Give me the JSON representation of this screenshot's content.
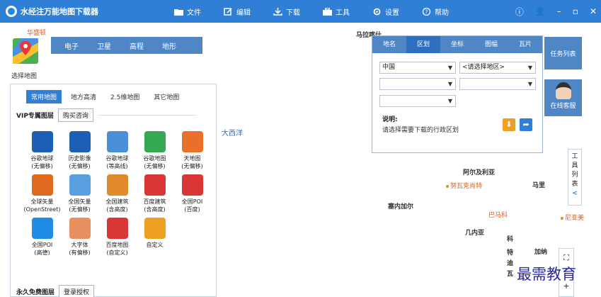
{
  "app": {
    "title": "水经注万能地图下载器",
    "menu": [
      {
        "label": "文件",
        "icon": "folder-icon"
      },
      {
        "label": "编辑",
        "icon": "edit-icon"
      },
      {
        "label": "下载",
        "icon": "download-icon"
      },
      {
        "label": "工具",
        "icon": "toolbox-icon"
      },
      {
        "label": "设置",
        "icon": "gear-icon"
      },
      {
        "label": "帮助",
        "icon": "help-icon"
      }
    ],
    "window_controls": [
      "ⓘ",
      "👤",
      "–",
      "▫",
      "✕"
    ]
  },
  "map": {
    "map_selector_label": "选择地图",
    "map_types": [
      "电子",
      "卫星",
      "高程",
      "地形"
    ],
    "ocean_label": "大西洋",
    "places": [
      {
        "text": "华盛顿"
      },
      {
        "text": "马拉喀什"
      },
      {
        "text": "阿尔及利亚"
      },
      {
        "text": "努瓦克肖特"
      },
      {
        "text": "马里"
      },
      {
        "text": "塞内加尔"
      },
      {
        "text": "巴马科"
      },
      {
        "text": "几内亚"
      },
      {
        "text": "科"
      },
      {
        "text": "特"
      },
      {
        "text": "迪"
      },
      {
        "text": "瓦"
      },
      {
        "text": "加纳"
      },
      {
        "text": "尼亚美"
      }
    ]
  },
  "left_panel": {
    "tabs": [
      "常用地图",
      "地方高清",
      "2.5维地图",
      "其它地图"
    ],
    "vip_section": {
      "title": "VIP专属图层",
      "button": "购买咨询"
    },
    "tiles": [
      {
        "name": "谷歌地球",
        "sub": "(无偏移)",
        "icon": "google-earth-icon",
        "color": "#1d5fb5"
      },
      {
        "name": "历史影像",
        "sub": "(无偏移)",
        "icon": "history-icon",
        "color": "#1d5fb5"
      },
      {
        "name": "谷歌地球",
        "sub": "(等高线)",
        "icon": "contour-icon",
        "color": "#4a90d9"
      },
      {
        "name": "谷歌地图",
        "sub": "(无偏移)",
        "icon": "google-maps-icon",
        "color": "#34a853"
      },
      {
        "name": "天地图",
        "sub": "(无偏移)",
        "icon": "tianditu-icon",
        "color": "#e8702a"
      },
      {
        "name": "全球矢量",
        "sub": "(OpenStreet)",
        "icon": "world-vector-icon",
        "color": "#e06a1e"
      },
      {
        "name": "全国矢量",
        "sub": "(无偏移)",
        "icon": "china-vector-icon",
        "color": "#5aa0e0"
      },
      {
        "name": "全国建筑",
        "sub": "(含高度)",
        "icon": "building-icon",
        "color": "#e08a2c"
      },
      {
        "name": "百度建筑",
        "sub": "(含高度)",
        "icon": "baidu-icon",
        "color": "#d93636"
      },
      {
        "name": "全国POI",
        "sub": "(百度)",
        "icon": "poi-icon",
        "color": "#d93636"
      },
      {
        "name": "全国POI",
        "sub": "(高德)",
        "icon": "poi-amap-icon",
        "color": "#1e8be6"
      },
      {
        "name": "大字体",
        "sub": "(有偏移)",
        "icon": "big-font-icon",
        "color": "#e89060"
      },
      {
        "name": "百度地图",
        "sub": "(自定义)",
        "icon": "baidu-map-icon",
        "color": "#d93636"
      },
      {
        "name": "自定义",
        "sub": "",
        "icon": "custom-edit-icon",
        "color": "#f0a020"
      }
    ],
    "free_section": {
      "title": "永久免费图层",
      "button": "登录授权"
    }
  },
  "region_panel": {
    "tabs": [
      "地名",
      "区划",
      "坐标",
      "图幅",
      "瓦片"
    ],
    "active_tab": "区划",
    "country_select": "中国",
    "region_select": "<请选择地区>",
    "note_title": "说明:",
    "note_text": "请选择需要下载的行政区划"
  },
  "right": {
    "task_list": "任务列表",
    "service": "在线客服",
    "toolbox": [
      "工",
      "具",
      "列",
      "表",
      "<"
    ],
    "zoom": [
      "⛶",
      "+"
    ]
  },
  "watermark": "最需教育"
}
